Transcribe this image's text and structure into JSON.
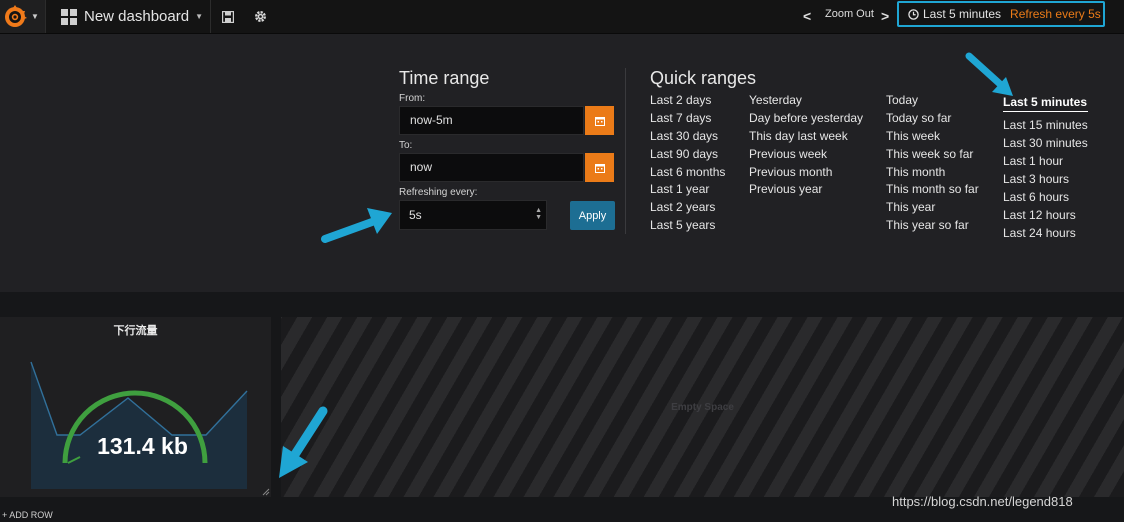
{
  "topbar": {
    "dashboard_title": "New dashboard",
    "zoom_out_label": "Zoom Out",
    "time_range_display": "Last 5 minutes",
    "refresh_display": "Refresh every 5s"
  },
  "time_range": {
    "heading": "Time range",
    "from_label": "From:",
    "from_value": "now-5m",
    "to_label": "To:",
    "to_value": "now",
    "refreshing_label": "Refreshing every:",
    "refreshing_value": "5s",
    "apply_label": "Apply"
  },
  "quick_ranges": {
    "heading": "Quick ranges",
    "col1": [
      "Last 2 days",
      "Last 7 days",
      "Last 30 days",
      "Last 90 days",
      "Last 6 months",
      "Last 1 year",
      "Last 2 years",
      "Last 5 years"
    ],
    "col2": [
      "Yesterday",
      "Day before yesterday",
      "This day last week",
      "Previous week",
      "Previous month",
      "Previous year"
    ],
    "col3": [
      "Today",
      "Today so far",
      "This week",
      "This week so far",
      "This month",
      "This month so far",
      "This year",
      "This year so far"
    ],
    "col4": [
      "Last 5 minutes",
      "Last 15 minutes",
      "Last 30 minutes",
      "Last 1 hour",
      "Last 3 hours",
      "Last 6 hours",
      "Last 12 hours",
      "Last 24 hours"
    ],
    "active": "Last 5 minutes"
  },
  "panel": {
    "title": "下行流量",
    "value": "131.4 kb",
    "gauge_color": "#3f9f3f",
    "sparkline_fill": "#1c2e3d",
    "sparkline_line": "#31709a"
  },
  "empty_space_label": "Empty Space",
  "add_row_label": "+ ADD ROW",
  "watermark": "https://blog.csdn.net/legend818",
  "colors": {
    "accent_orange": "#eb7b18",
    "highlight_blue": "#1fa6d4",
    "apply_blue": "#1d6e93"
  }
}
